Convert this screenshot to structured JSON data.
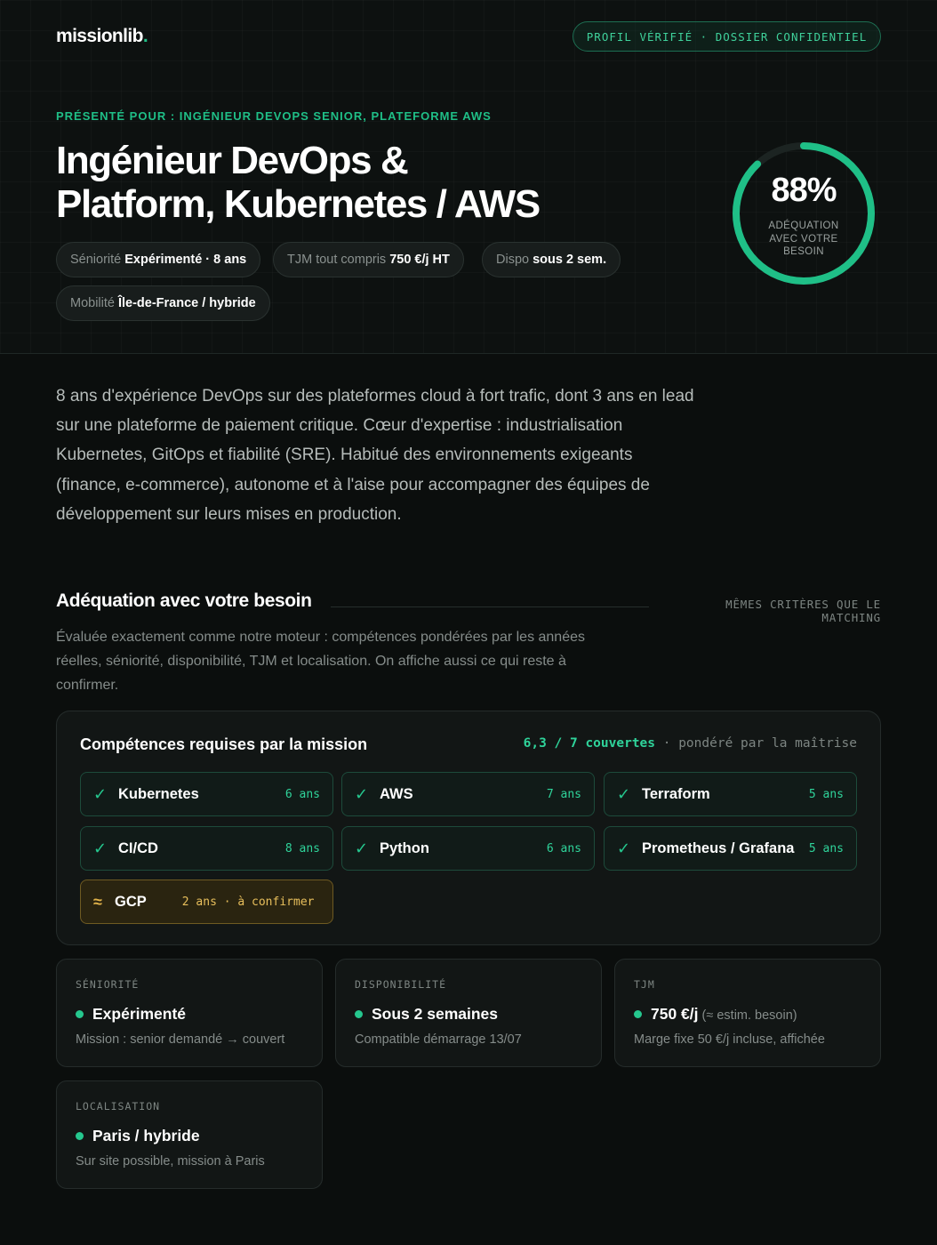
{
  "header": {
    "logo_text": "missionlib",
    "logo_dot": ".",
    "badge": "PROFIL VÉRIFIÉ · DOSSIER CONFIDENTIEL"
  },
  "hero": {
    "presented_for": "Présenté pour : Ingénieur DevOps Senior, Plateforme AWS",
    "title_line1": "Ingénieur DevOps &",
    "title_line2": "Platform, Kubernetes / AWS",
    "chips": [
      {
        "key": "Séniorité",
        "value": "Expérimenté · 8 ans"
      },
      {
        "key": "TJM tout compris",
        "value": "750 €/j HT"
      },
      {
        "key": "Dispo",
        "value": "sous 2 sem."
      },
      {
        "key": "Mobilité",
        "value": "Île-de-France / hybride"
      }
    ],
    "match": {
      "percent_label": "88%",
      "percent_value": 88,
      "label": "Adéquation avec votre besoin",
      "color": "#1fbf87"
    }
  },
  "intro": "8 ans d'expérience DevOps sur des plateformes cloud à fort trafic, dont 3 ans en lead sur une plateforme de paiement critique. Cœur d'expertise : industrialisation Kubernetes, GitOps et fiabilité (SRE). Habitué des environnements exigeants (finance, e-commerce), autonome et à l'aise pour accompagner des équipes de développement sur leurs mises en production.",
  "adequation": {
    "title": "Adéquation avec votre besoin",
    "note": "MÊMES CRITÈRES QUE LE MATCHING",
    "description": "Évaluée exactement comme notre moteur : compétences pondérées par les années réelles, séniorité, disponibilité, TJM et localisation. On affiche aussi ce qui reste à confirmer."
  },
  "skills": {
    "title": "Compétences requises par la mission",
    "coverage": "6,3 / 7 couvertes",
    "coverage_note": " · pondéré par la maîtrise",
    "items": [
      {
        "icon": "✓",
        "name": "Kubernetes",
        "years": "6 ans"
      },
      {
        "icon": "✓",
        "name": "AWS",
        "years": "7 ans"
      },
      {
        "icon": "✓",
        "name": "Terraform",
        "years": "5 ans"
      },
      {
        "icon": "✓",
        "name": "CI/CD",
        "years": "8 ans"
      },
      {
        "icon": "✓",
        "name": "Python",
        "years": "6 ans"
      },
      {
        "icon": "✓",
        "name": "Prometheus / Grafana",
        "years": "5 ans"
      },
      {
        "icon": "≈",
        "name": "GCP",
        "years": "2 ans · à confirmer"
      }
    ]
  },
  "criteria": [
    {
      "label": "SÉNIORITÉ",
      "value": "Expérimenté",
      "note": "",
      "sub": "Mission : senior demandé → couvert"
    },
    {
      "label": "DISPONIBILITÉ",
      "value": "Sous 2 semaines",
      "note": "",
      "sub": "Compatible démarrage 13/07"
    },
    {
      "label": "TJM",
      "value": "750 €/j",
      "note": "(≈ estim. besoin)",
      "sub": "Marge fixe 50 €/j incluse, affichée"
    },
    {
      "label": "LOCALISATION",
      "value": "Paris / hybride",
      "note": "",
      "sub": "Sur site possible, mission à Paris"
    }
  ]
}
